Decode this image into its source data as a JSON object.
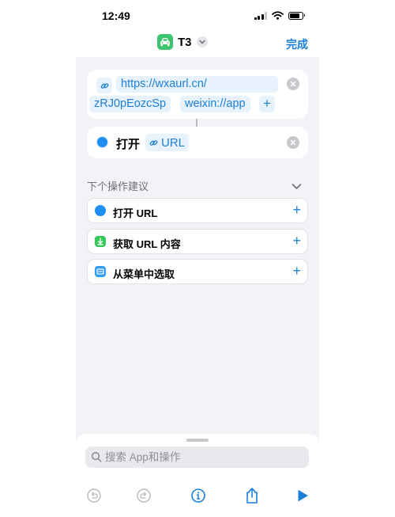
{
  "status_bar": {
    "time": "12:49"
  },
  "nav": {
    "title": "T3",
    "done_label": "完成"
  },
  "action1": {
    "token_url": "https://wxaurl.cn/",
    "token_path": "zRJ0pEozcSp",
    "token_scheme": "weixin://app",
    "add_symbol": "+"
  },
  "action2": {
    "label": "打开",
    "param": "URL"
  },
  "suggestions": {
    "header": "下个操作建议",
    "items": [
      {
        "label": "打开 URL",
        "icon": "safari-icon",
        "color": "#1e8ef0"
      },
      {
        "label": "获取 URL 内容",
        "icon": "download-icon",
        "color": "#34c759"
      },
      {
        "label": "从菜单中选取",
        "icon": "menu-icon",
        "color": "#2f9cf2"
      }
    ],
    "add_symbol": "+"
  },
  "search": {
    "placeholder": "搜索 App和操作"
  },
  "colors": {
    "accent": "#1a7fd8",
    "background": "#f2f2f7",
    "car_badge": "#3ec46d"
  }
}
